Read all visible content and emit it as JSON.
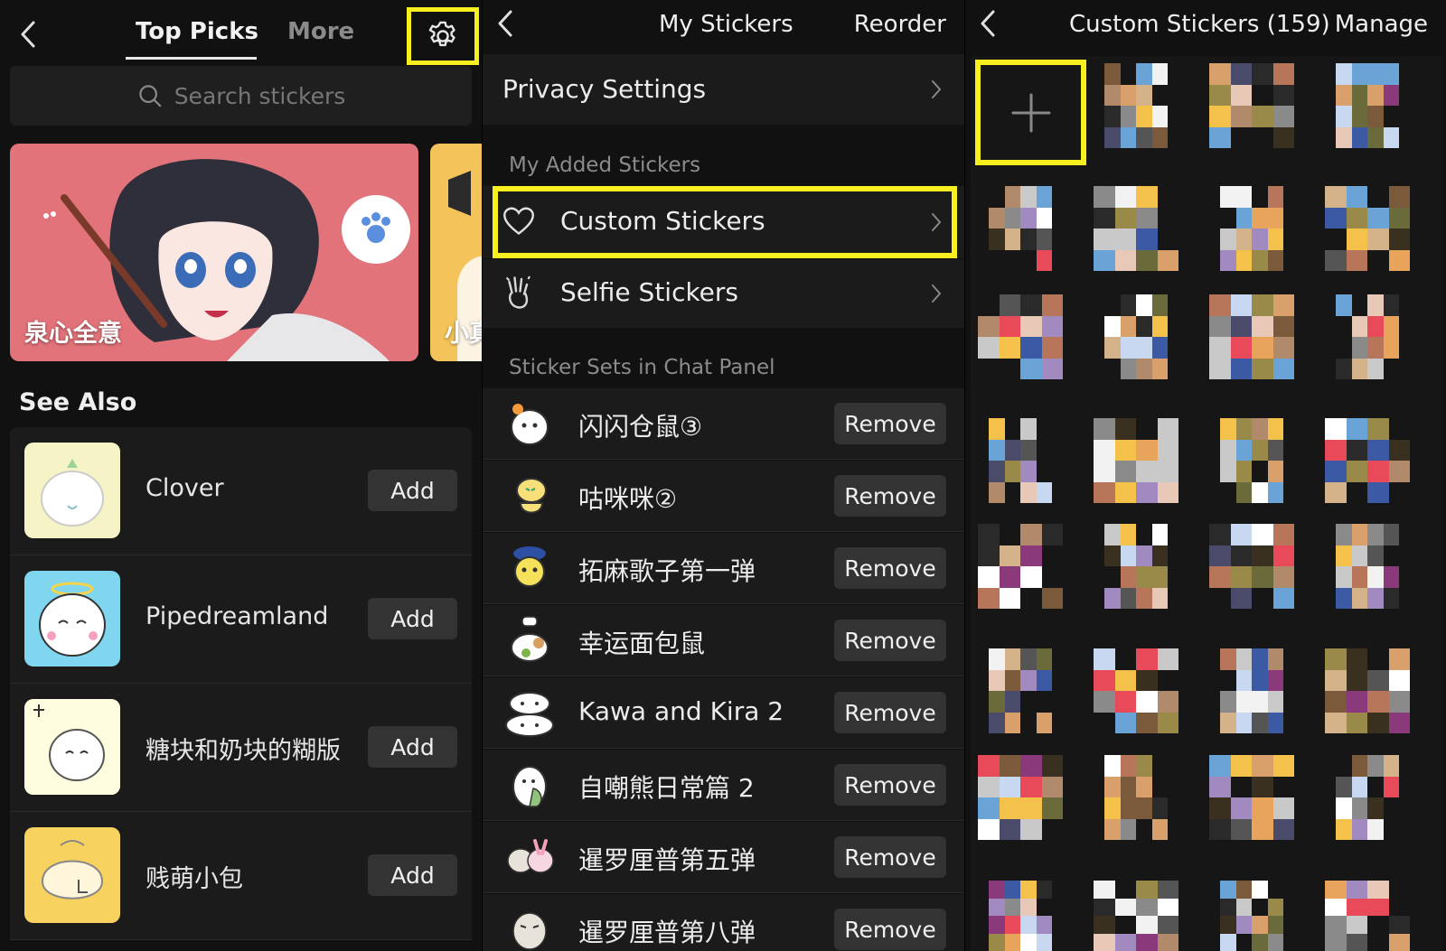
{
  "colors": {
    "highlight": "#f7ef1f",
    "bg": "#111111",
    "row": "#1b1b1b",
    "button": "#333333"
  },
  "top_picks": {
    "tabs": [
      {
        "label": "Top Picks",
        "active": true
      },
      {
        "label": "More",
        "active": false
      }
    ],
    "settings_icon": "gear-icon",
    "search": {
      "placeholder": "Search stickers"
    },
    "banners": [
      {
        "label": "泉心全意"
      },
      {
        "label": "小真"
      }
    ],
    "see_also": {
      "heading": "See Also",
      "items": [
        {
          "name": "Clover",
          "action": "Add"
        },
        {
          "name": "Pipedreamland",
          "action": "Add"
        },
        {
          "name": "糖块和奶块的糊版",
          "action": "Add"
        },
        {
          "name": "贱萌小包",
          "action": "Add"
        }
      ]
    }
  },
  "my_stickers": {
    "title": "My Stickers",
    "action": "Reorder",
    "privacy": "Privacy Settings",
    "added_heading": "My Added Stickers",
    "custom": "Custom Stickers",
    "selfie": "Selfie Stickers",
    "sets_heading": "Sticker Sets in Chat Panel",
    "sets": [
      {
        "name": "闪闪仓鼠③",
        "action": "Remove"
      },
      {
        "name": "咕咪咪②",
        "action": "Remove"
      },
      {
        "name": "拓麻歌子第一弹",
        "action": "Remove"
      },
      {
        "name": "幸运面包鼠",
        "action": "Remove"
      },
      {
        "name": "Kawa and Kira 2",
        "action": "Remove"
      },
      {
        "name": "自嘲熊日常篇 2",
        "action": "Remove"
      },
      {
        "name": "暹罗厘普第五弹",
        "action": "Remove"
      },
      {
        "name": "暹罗厘普第八弹",
        "action": "Remove"
      }
    ]
  },
  "custom_stickers": {
    "title": "Custom Stickers (159)",
    "action": "Manage",
    "add_icon": "plus-icon"
  }
}
